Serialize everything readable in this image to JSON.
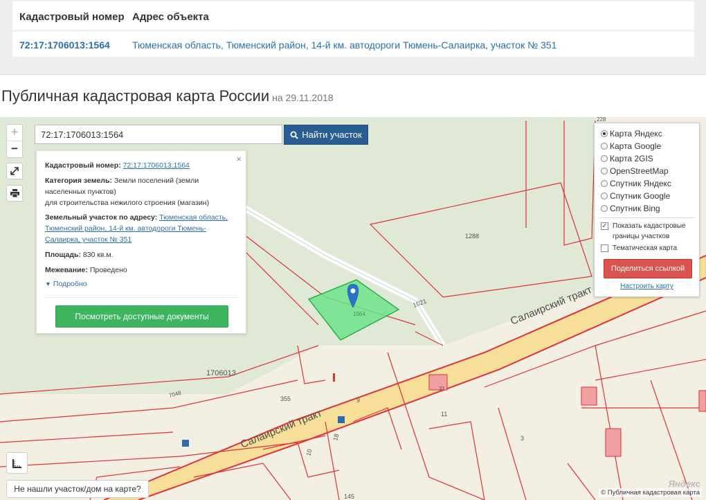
{
  "results_table": {
    "col_cadastral": "Кадастровый номер",
    "col_address": "Адрес объекта",
    "rows": [
      {
        "cadastral": "72:17:1706013:1564",
        "address": "Тюменская область, Тюменский район, 14-й км. автодороги Тюмень-Салаирка, участок № 351"
      }
    ]
  },
  "page": {
    "title": "Публичная кадастровая карта России",
    "date": "на 29.11.2018"
  },
  "map": {
    "zoom_in": "+",
    "zoom_out": "−",
    "search_value": "72:17:1706013:1564",
    "search_button": "Найти участок",
    "info": {
      "cad_label": "Кадастровый номер:",
      "cad_value": "72:17:1706013:1564",
      "category_label": "Категория земель:",
      "category_value": "Земли поселений (земли населенных пунктов)",
      "category_use": "для строительства нежилого строения (магазин)",
      "address_label": "Земельный участок по адресу:",
      "address_value": "Тюменская область, Тюменский район, 14-й км. автодороги Тюмень-Салаирка, участок № 351",
      "area_label": "Площадь:",
      "area_value": "830 кв.м.",
      "survey_label": "Межевание:",
      "survey_value": "Проведено",
      "more": "Подробно",
      "docs_button": "Посмотреть доступные документы",
      "close": "×"
    },
    "layers": {
      "options": [
        {
          "label": "Карта Яндекс",
          "selected": true
        },
        {
          "label": "Карта Google",
          "selected": false
        },
        {
          "label": "Карта 2GIS",
          "selected": false
        },
        {
          "label": "OpenStreetMap",
          "selected": false
        },
        {
          "label": "Спутник Яндекс",
          "selected": false
        },
        {
          "label": "Спутник Google",
          "selected": false
        },
        {
          "label": "Спутник Bing",
          "selected": false
        }
      ],
      "show_borders": "Показать кадастровые границы участков",
      "show_borders_checked": true,
      "thematic": "Тематическая карта",
      "thematic_checked": false,
      "share_button": "Поделиться ссылкой",
      "config_link": "Настроить карту"
    },
    "labels": {
      "road1": "Салаирский тракт",
      "road2": "Салаирский тракт",
      "parcel": "1564",
      "p1288": "1288",
      "p1021": "1021",
      "block": "1706013",
      "p7048": "7048",
      "p355": "355",
      "p9": "9",
      "p11": "11",
      "p3": "3",
      "p18": "18",
      "p10": "10",
      "p145": "145",
      "p228": "228",
      "p31": "31"
    },
    "not_found": "Не нашли участок/дом на карте?",
    "copyright": "© Публичная кадастровая карта",
    "yandex": "Яндекс",
    "colors": {
      "boundary": "#e0303a",
      "parcel_fill": "#6ee38a",
      "road_fill": "#f7df9a",
      "forest": "#dfead6"
    }
  }
}
